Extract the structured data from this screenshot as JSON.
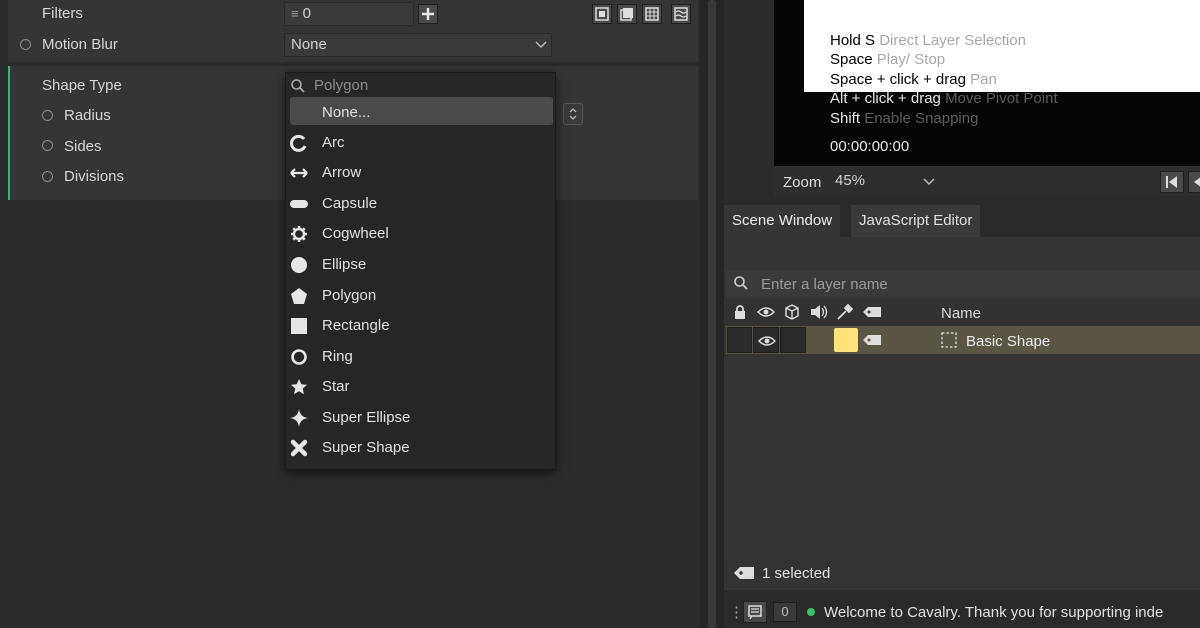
{
  "attributes": {
    "filters_label": "Filters",
    "filters_value": "0",
    "motion_blur_label": "Motion Blur",
    "motion_blur_value": "None",
    "shape_type_label": "Shape Type",
    "radius_label": "Radius",
    "sides_label": "Sides",
    "divisions_label": "Divisions"
  },
  "dropdown": {
    "search_placeholder": "Polygon",
    "none_label": "None...",
    "items": [
      {
        "label": "Arc",
        "icon": "arc-icon"
      },
      {
        "label": "Arrow",
        "icon": "arrow-icon"
      },
      {
        "label": "Capsule",
        "icon": "capsule-icon"
      },
      {
        "label": "Cogwheel",
        "icon": "cogwheel-icon"
      },
      {
        "label": "Ellipse",
        "icon": "ellipse-icon"
      },
      {
        "label": "Polygon",
        "icon": "polygon-icon"
      },
      {
        "label": "Rectangle",
        "icon": "rectangle-icon"
      },
      {
        "label": "Ring",
        "icon": "ring-icon"
      },
      {
        "label": "Star",
        "icon": "star-icon"
      },
      {
        "label": "Super Ellipse",
        "icon": "super-ellipse-icon"
      },
      {
        "label": "Super Shape",
        "icon": "super-shape-icon"
      }
    ]
  },
  "viewport": {
    "hints": [
      {
        "key": "Hold S",
        "desc": "Direct Layer Selection"
      },
      {
        "key": "Space",
        "desc": "Play/ Stop"
      },
      {
        "key": "Space + click + drag",
        "desc": "Pan"
      },
      {
        "key": "Alt + click + drag",
        "desc": "Move Pivot Point"
      },
      {
        "key": "Shift",
        "desc": "Enable Snapping"
      }
    ],
    "timecode": "00:00:00:00",
    "zoom_label": "Zoom",
    "zoom_value": "45%"
  },
  "tabs": [
    {
      "label": "Scene Window"
    },
    {
      "label": "JavaScript Editor"
    }
  ],
  "scene": {
    "search_placeholder": "Enter a layer name",
    "name_header": "Name",
    "layer_name": "Basic Shape",
    "layer_color": "#ffe27a",
    "selected_text": "1 selected"
  },
  "console": {
    "count": "0",
    "message": "Welcome to Cavalry. Thank you for supporting inde",
    "status_color": "#35c46a"
  }
}
